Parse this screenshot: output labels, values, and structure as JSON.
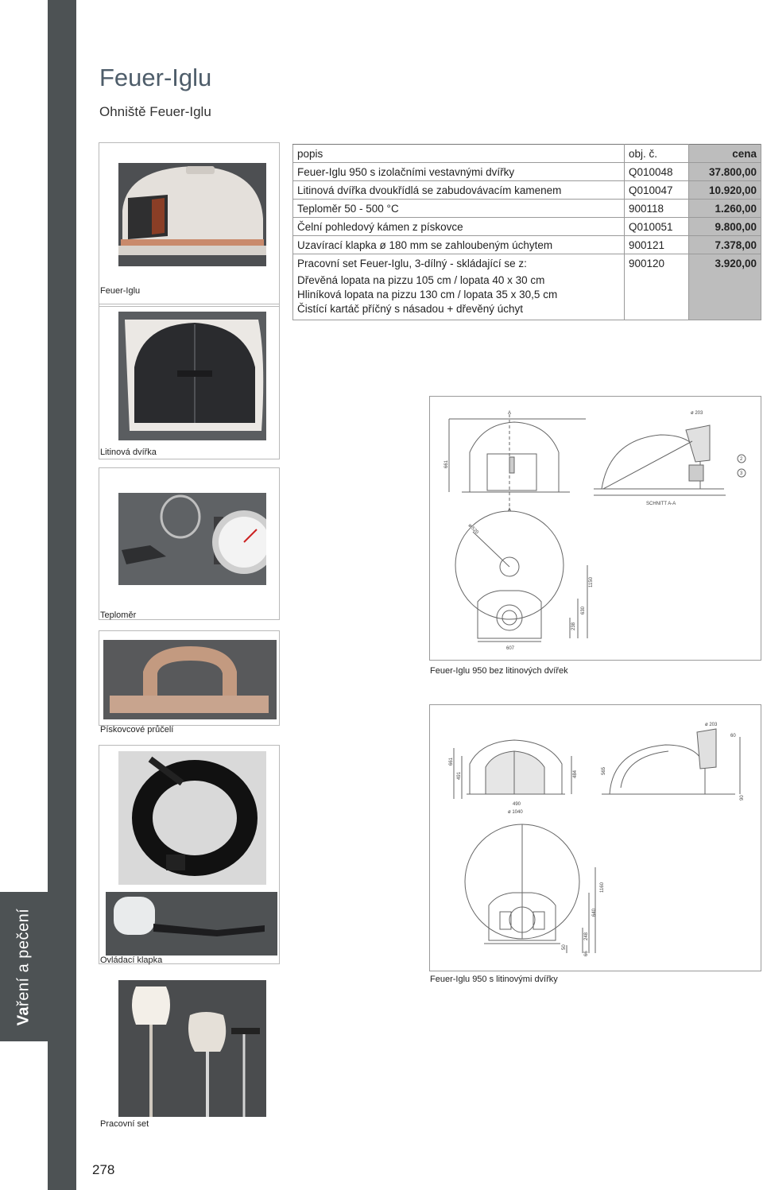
{
  "page": {
    "title": "Feuer-Iglu",
    "subtitle": "Ohniště Feuer-Iglu",
    "page_number": "278"
  },
  "side_tab": {
    "part1": "Va",
    "part2": "ření a pečení"
  },
  "table": {
    "headers": {
      "desc": "popis",
      "code": "obj. č.",
      "price": "cena"
    },
    "rows": [
      {
        "desc": "Feuer-Iglu 950 s izolačními vestavnými dvířky",
        "code": "Q010048",
        "price": "37.800,00"
      },
      {
        "desc": "Litinová dvířka dvoukřídlá se zabudovávacím kamenem",
        "code": "Q010047",
        "price": "10.920,00"
      },
      {
        "desc": "Teploměr 50 - 500 °C",
        "code": "900118",
        "price": "1.260,00"
      },
      {
        "desc": "Čelní pohledový kámen z pískovce",
        "code": "Q010051",
        "price": "9.800,00"
      },
      {
        "desc": "Uzavírací klapka ø 180 mm se zahloubeným úchytem",
        "code": "900121",
        "price": "7.378,00"
      },
      {
        "desc": "Pracovní set Feuer-Iglu, 3-dílný - skládající se z:",
        "code": "900120",
        "price": "3.920,00"
      }
    ],
    "set_items": [
      "Dřevěná lopata na pizzu 105 cm / lopata 40 x 30 cm",
      "Hliníková lopata na pizzu 130 cm / lopata 35 x 30,5 cm",
      "Čistící kartáč příčný s násadou + dřevěný úchyt"
    ]
  },
  "captions": {
    "iglu": "Feuer-Iglu",
    "door": "Litinová dvířka",
    "thermo": "Teploměr",
    "stone": "Pískovcové průčelí",
    "flap": "Ovládací klapka",
    "set": "Pracovní set"
  },
  "diagrams": {
    "d1_caption": "Feuer-Iglu 950 bez litinových dvířek",
    "d2_caption": "Feuer-Iglu 950 s litinovými dvířky",
    "d1_labels": {
      "a_top": "A",
      "a_bottom": "A",
      "dia203": "ø 203",
      "h661": "661",
      "section": "SCHNITT A-A",
      "r520": "ø 520",
      "w607": "607",
      "h1150": "1150",
      "h630": "630",
      "h238": "238",
      "n2": "2",
      "n3": "3"
    },
    "d2_labels": {
      "dia203": "ø 203",
      "n60": "60",
      "h661": "661",
      "h491": "491",
      "h484": "484",
      "h565": "565",
      "w490": "490",
      "w1040": "ø 1040",
      "h90": "90",
      "h1160": "1160",
      "h640": "640",
      "h248": "248",
      "h50": "50",
      "h66": "66"
    }
  }
}
